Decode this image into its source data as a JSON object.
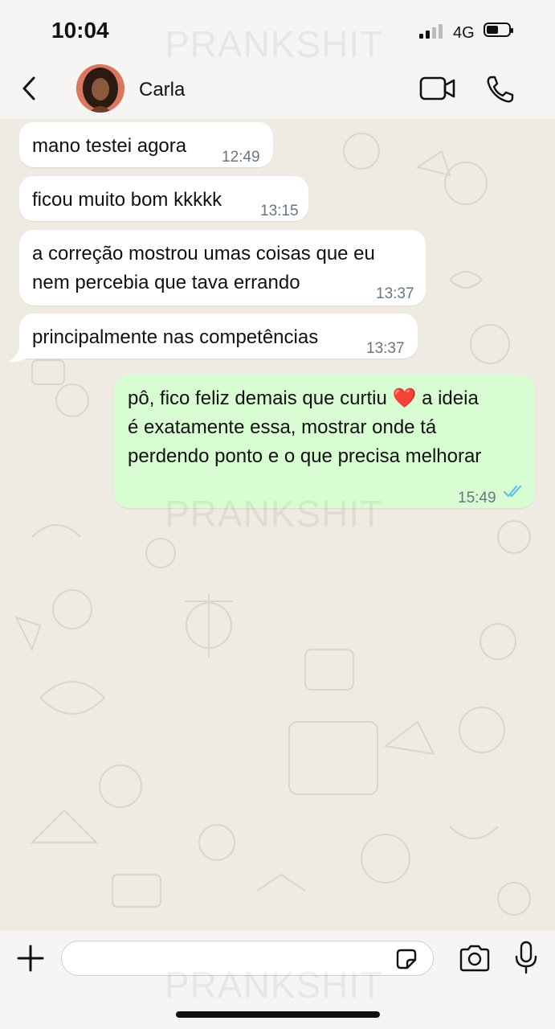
{
  "status_bar": {
    "time": "10:04",
    "network": "4G",
    "watermark": "PRANKSHIT"
  },
  "header": {
    "contact_name": "Carla",
    "icons": [
      "back-chevron-icon",
      "video-call-icon",
      "phone-call-icon"
    ]
  },
  "messages": [
    {
      "direction": "incoming",
      "text": "mano testei agora",
      "time": "12:49"
    },
    {
      "direction": "incoming",
      "text": "ficou muito bom kkkkk",
      "time": "13:15"
    },
    {
      "direction": "incoming",
      "text_line1": "a correção mostrou umas coisas que eu",
      "text_line2": "nem percebia que tava errando",
      "time": "13:37"
    },
    {
      "direction": "incoming",
      "text": "principalmente nas competências",
      "time": "13:37"
    },
    {
      "direction": "outgoing",
      "text_line1a": "pô, fico feliz demais que curtiu",
      "emoji": "❤️",
      "text_line1b": "a ideia",
      "text_line2": "é exatamente essa, mostrar onde tá",
      "text_line3": "perdendo ponto e o que precisa melhorar",
      "time": "15:49",
      "read": true
    }
  ],
  "composer": {
    "placeholder": "",
    "icons": [
      "plus-icon",
      "sticker-icon",
      "camera-icon",
      "microphone-icon"
    ]
  },
  "colors": {
    "incoming_bubble": "#ffffff",
    "outgoing_bubble": "#d9fdd3",
    "chat_background": "#efeae2",
    "read_ticks": "#53bdeb"
  }
}
